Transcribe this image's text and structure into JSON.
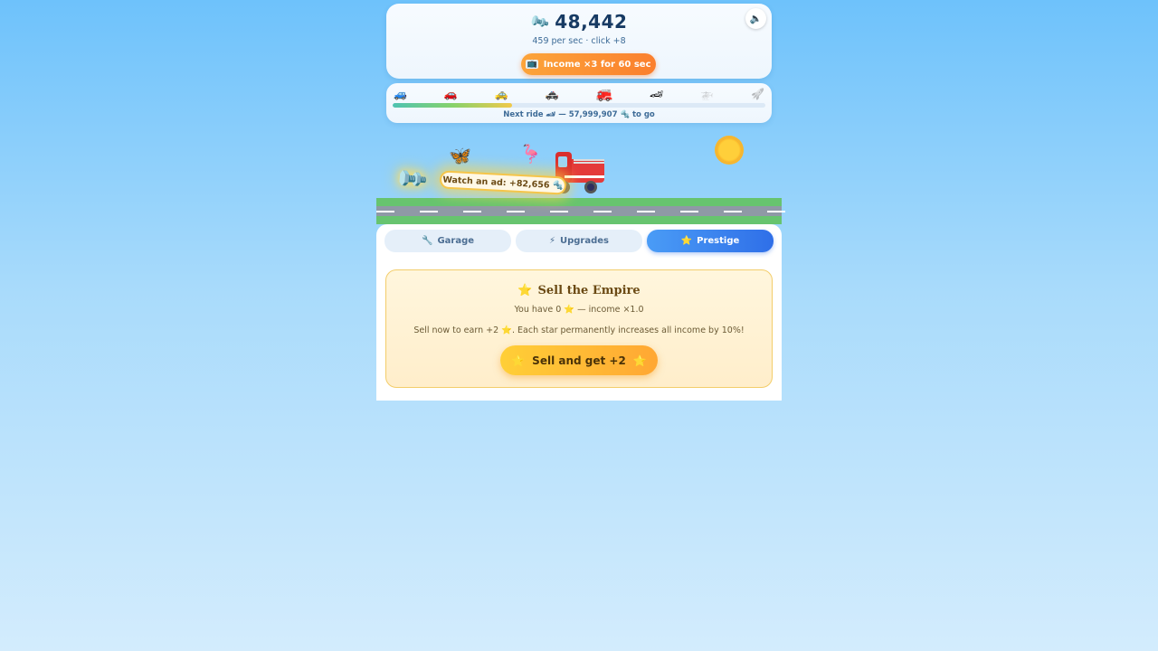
{
  "header": {
    "currency_icon": "bolt-icon",
    "score": "48,442",
    "rate": "459 per sec · click +8",
    "sound_icon": "speaker-icon",
    "boost": {
      "icon": "tv-icon",
      "label": "Income ×3 for 60 sec",
      "color": "#fb7f2d"
    }
  },
  "progress": {
    "rides": [
      {
        "icon": "blue-car",
        "glyph": "🚙",
        "state": "unlocked"
      },
      {
        "icon": "red-car",
        "glyph": "🚗",
        "state": "unlocked"
      },
      {
        "icon": "taxi",
        "glyph": "🚕",
        "state": "unlocked"
      },
      {
        "icon": "police-car",
        "glyph": "🚓",
        "state": "unlocked"
      },
      {
        "icon": "fire-truck",
        "glyph": "🚒",
        "state": "current"
      },
      {
        "icon": "race-car",
        "glyph": "🏎",
        "state": "unlocked"
      },
      {
        "icon": "helicopter",
        "glyph": "🚁",
        "state": "locked"
      },
      {
        "icon": "rocket",
        "glyph": "🚀",
        "state": "locked"
      }
    ],
    "fraction": 0.32,
    "next_text": "Next ride 🏎 — 57,999,907 🔩 to go"
  },
  "scene": {
    "ad_pill": "Watch an ad: +82,656 🔩",
    "pickup_icon": "wrench-icon",
    "butterfly": "🦋",
    "flamingo": "🦩"
  },
  "tabs": [
    {
      "id": "garage",
      "icon": "🔧",
      "label": "Garage",
      "active": false
    },
    {
      "id": "upgrades",
      "icon": "⚡",
      "label": "Upgrades",
      "active": false
    },
    {
      "id": "prestige",
      "icon": "⭐",
      "label": "Prestige",
      "active": true
    }
  ],
  "prestige": {
    "title": "Sell the Empire",
    "have": "You have 0 ⭐ — income ×1.0",
    "desc": "Sell now to earn +2 ⭐. Each star permanently increases all income by 10%!",
    "button": "Sell and get +2"
  }
}
